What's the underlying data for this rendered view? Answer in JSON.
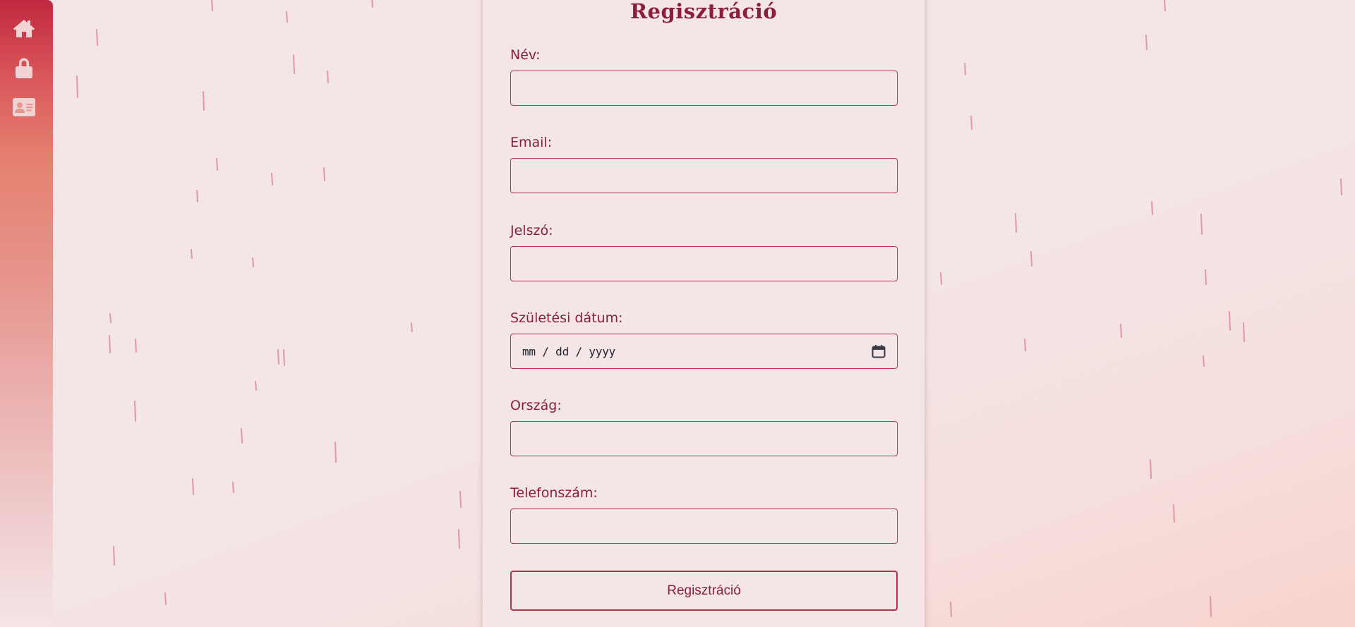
{
  "nav": {
    "items": [
      {
        "icon": "home-icon"
      },
      {
        "icon": "lock-icon"
      },
      {
        "icon": "id-card-icon"
      }
    ]
  },
  "form": {
    "title": "Regisztráció",
    "fields": {
      "name": {
        "label": "Név:",
        "value": ""
      },
      "email": {
        "label": "Email:",
        "value": ""
      },
      "password": {
        "label": "Jelszó:",
        "value": ""
      },
      "birthdate": {
        "label": "Születési dátum:",
        "placeholder": "mm / dd / yyyy",
        "icon": "calendar-icon"
      },
      "country": {
        "label": "Ország:",
        "value": ""
      },
      "phone": {
        "label": "Telefonszám:",
        "value": ""
      }
    },
    "submit_label": "Regisztráció"
  },
  "colors": {
    "accent": "#8c1d3e",
    "border": "#b3334f",
    "background": "#f4e5e6",
    "sidebar_top": "#c0283f",
    "rain": "#dd8b9c"
  }
}
